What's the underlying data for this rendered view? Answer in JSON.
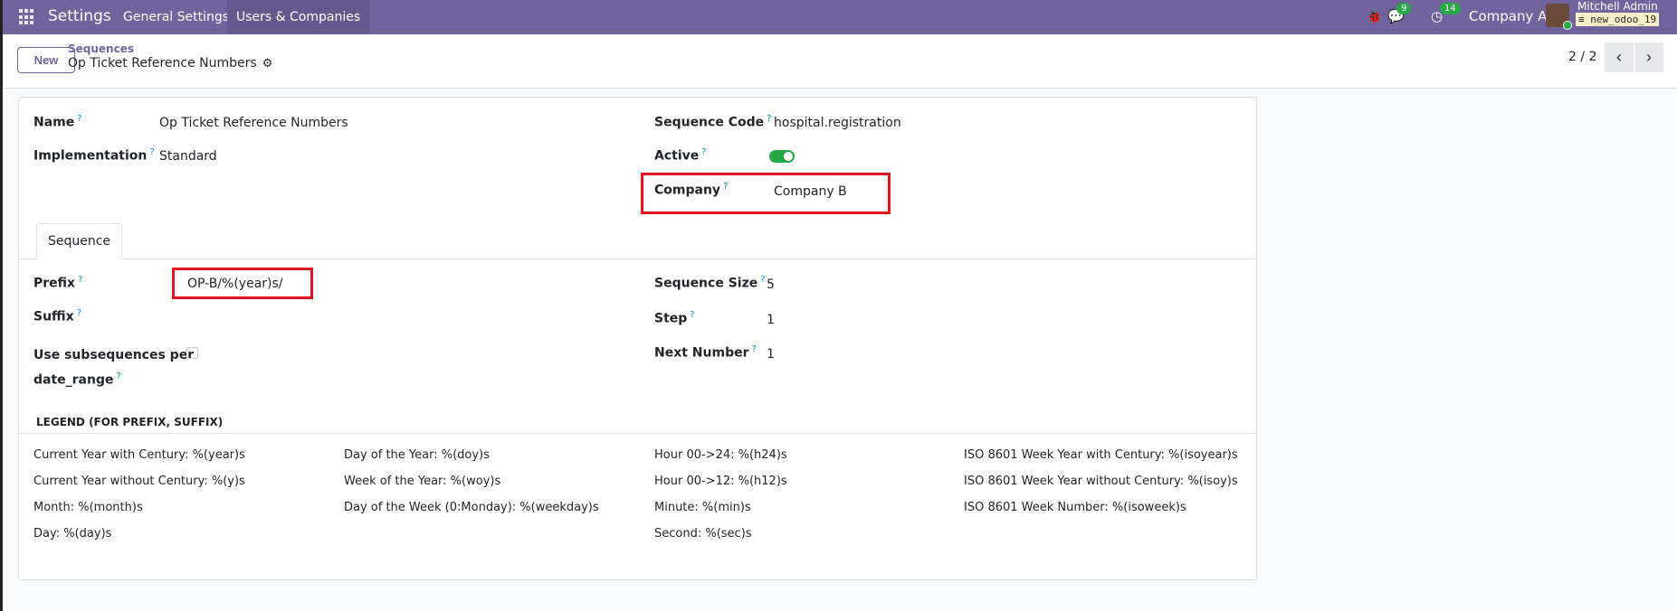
{
  "nav": {
    "app": "Settings",
    "menus": [
      "General Settings",
      "Users & Companies"
    ],
    "messages_badge": "9",
    "activities_badge": "14",
    "company": "Company A",
    "user": "Mitchell Admin",
    "database": "new_odoo_19"
  },
  "control": {
    "new_label": "New",
    "breadcrumb_parent": "Sequences",
    "breadcrumb_current": "Op Ticket Reference Numbers",
    "pager": "2 / 2"
  },
  "form": {
    "name": {
      "label": "Name",
      "value": "Op Ticket Reference Numbers"
    },
    "implementation": {
      "label": "Implementation",
      "value": "Standard"
    },
    "sequence_code": {
      "label": "Sequence Code",
      "value": "hospital.registration"
    },
    "active": {
      "label": "Active",
      "value": true
    },
    "company": {
      "label": "Company",
      "value": "Company B"
    },
    "tab": "Sequence",
    "prefix": {
      "label": "Prefix",
      "value": "OP-B/%(year)s/"
    },
    "suffix": {
      "label": "Suffix",
      "value": ""
    },
    "subseq": {
      "label1": "Use subsequences per",
      "label2": "date_range",
      "value": false
    },
    "size": {
      "label": "Sequence Size",
      "value": "5"
    },
    "step": {
      "label": "Step",
      "value": "1"
    },
    "next": {
      "label": "Next Number",
      "value": "1"
    },
    "help": "?"
  },
  "legend": {
    "title": "LEGEND (FOR PREFIX, SUFFIX)",
    "columns": [
      [
        "Current Year with Century: %(year)s",
        "Current Year without Century: %(y)s",
        "Month: %(month)s",
        "Day: %(day)s"
      ],
      [
        "Day of the Year: %(doy)s",
        "Week of the Year: %(woy)s",
        "Day of the Week (0:Monday): %(weekday)s"
      ],
      [
        "Hour 00->24: %(h24)s",
        "Hour 00->12: %(h12)s",
        "Minute: %(min)s",
        "Second: %(sec)s"
      ],
      [
        "ISO 8601 Week Year with Century: %(isoyear)s",
        "ISO 8601 Week Year without Century: %(isoy)s",
        "ISO 8601 Week Number: %(isoweek)s"
      ]
    ]
  }
}
